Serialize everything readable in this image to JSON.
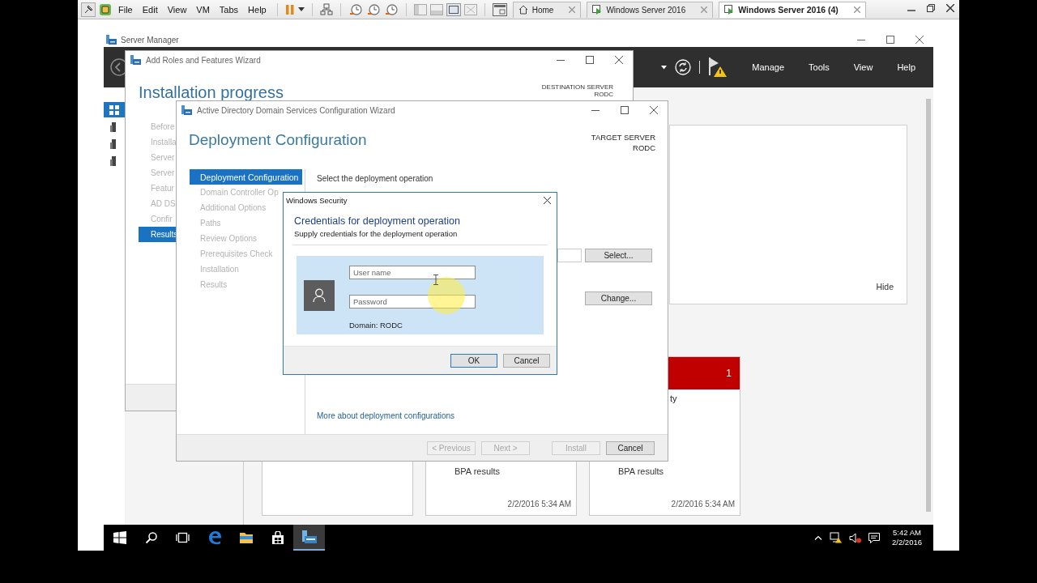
{
  "vm_toolbar": {
    "menus": [
      "File",
      "Edit",
      "View",
      "VM",
      "Tabs",
      "Help"
    ],
    "tabs": [
      {
        "label": "Home",
        "kind": "home",
        "selected": false
      },
      {
        "label": "Windows Server 2016",
        "kind": "vm",
        "selected": false
      },
      {
        "label": "Windows Server 2016 (4)",
        "kind": "vm",
        "selected": true
      }
    ]
  },
  "server_manager": {
    "title": "Server Manager",
    "menu": [
      "Manage",
      "Tools",
      "View",
      "Help"
    ],
    "nav": [
      {
        "selected": true
      },
      {
        "selected": false
      },
      {
        "selected": false
      },
      {
        "selected": false
      }
    ],
    "panel_action": "Hide",
    "tiles": [
      {
        "kind": "plain"
      },
      {
        "kind": "plain",
        "label": "BPA results",
        "date": "2/2/2016 5:34 AM"
      },
      {
        "kind": "alert",
        "count": "1",
        "status": "ty",
        "label": "BPA results",
        "date": "2/2/2016 5:34 AM"
      }
    ]
  },
  "roles_wizard": {
    "title": "Add Roles and Features Wizard",
    "heading": "Installation progress",
    "server_label": "DESTINATION SERVER",
    "server_name": "RODC",
    "steps": [
      {
        "label": "Before",
        "selected": false
      },
      {
        "label": "Installa",
        "selected": false
      },
      {
        "label": "Server",
        "selected": false
      },
      {
        "label": "Server",
        "selected": false
      },
      {
        "label": "Featur",
        "selected": false
      },
      {
        "label": "AD DS",
        "selected": false
      },
      {
        "label": "Confir",
        "selected": false
      },
      {
        "label": "Results",
        "selected": true
      }
    ]
  },
  "adds_wizard": {
    "title": "Active Directory Domain Services Configuration Wizard",
    "heading": "Deployment Configuration",
    "server_label": "TARGET SERVER",
    "server_name": "RODC",
    "steps": [
      {
        "label": "Deployment Configuration",
        "selected": true
      },
      {
        "label": "Domain Controller Op",
        "selected": false
      },
      {
        "label": "Additional Options",
        "selected": false
      },
      {
        "label": "Paths",
        "selected": false
      },
      {
        "label": "Review Options",
        "selected": false
      },
      {
        "label": "Prerequisites Check",
        "selected": false
      },
      {
        "label": "Installation",
        "selected": false
      },
      {
        "label": "Results",
        "selected": false
      }
    ],
    "prompt": "Select the deployment operation",
    "select_button": "Select...",
    "change_button": "Change...",
    "link": "More about deployment configurations",
    "footer_buttons": [
      {
        "label": "< Previous",
        "disabled": true
      },
      {
        "label": "Next >",
        "disabled": true
      },
      {
        "label": "Install",
        "disabled": true
      },
      {
        "label": "Cancel",
        "disabled": false
      }
    ]
  },
  "security_dialog": {
    "title": "Windows Security",
    "heading": "Credentials for deployment operation",
    "subtitle": "Supply credentials for the deployment operation",
    "username": {
      "placeholder": "User name"
    },
    "password": {
      "placeholder": "Password"
    },
    "domain": "Domain: RODC",
    "buttons": [
      {
        "label": "OK",
        "default": true
      },
      {
        "label": "Cancel",
        "default": false
      }
    ]
  },
  "taskbar": {
    "apps": [
      {
        "kind": "start",
        "selected": false
      },
      {
        "kind": "search",
        "selected": false
      },
      {
        "kind": "task-view",
        "selected": false
      },
      {
        "kind": "edge",
        "selected": false
      },
      {
        "kind": "explorer",
        "selected": false
      },
      {
        "kind": "store",
        "selected": false
      },
      {
        "kind": "server-manager",
        "selected": true
      }
    ],
    "time": "5:42 AM",
    "date": "2/2/2016"
  }
}
